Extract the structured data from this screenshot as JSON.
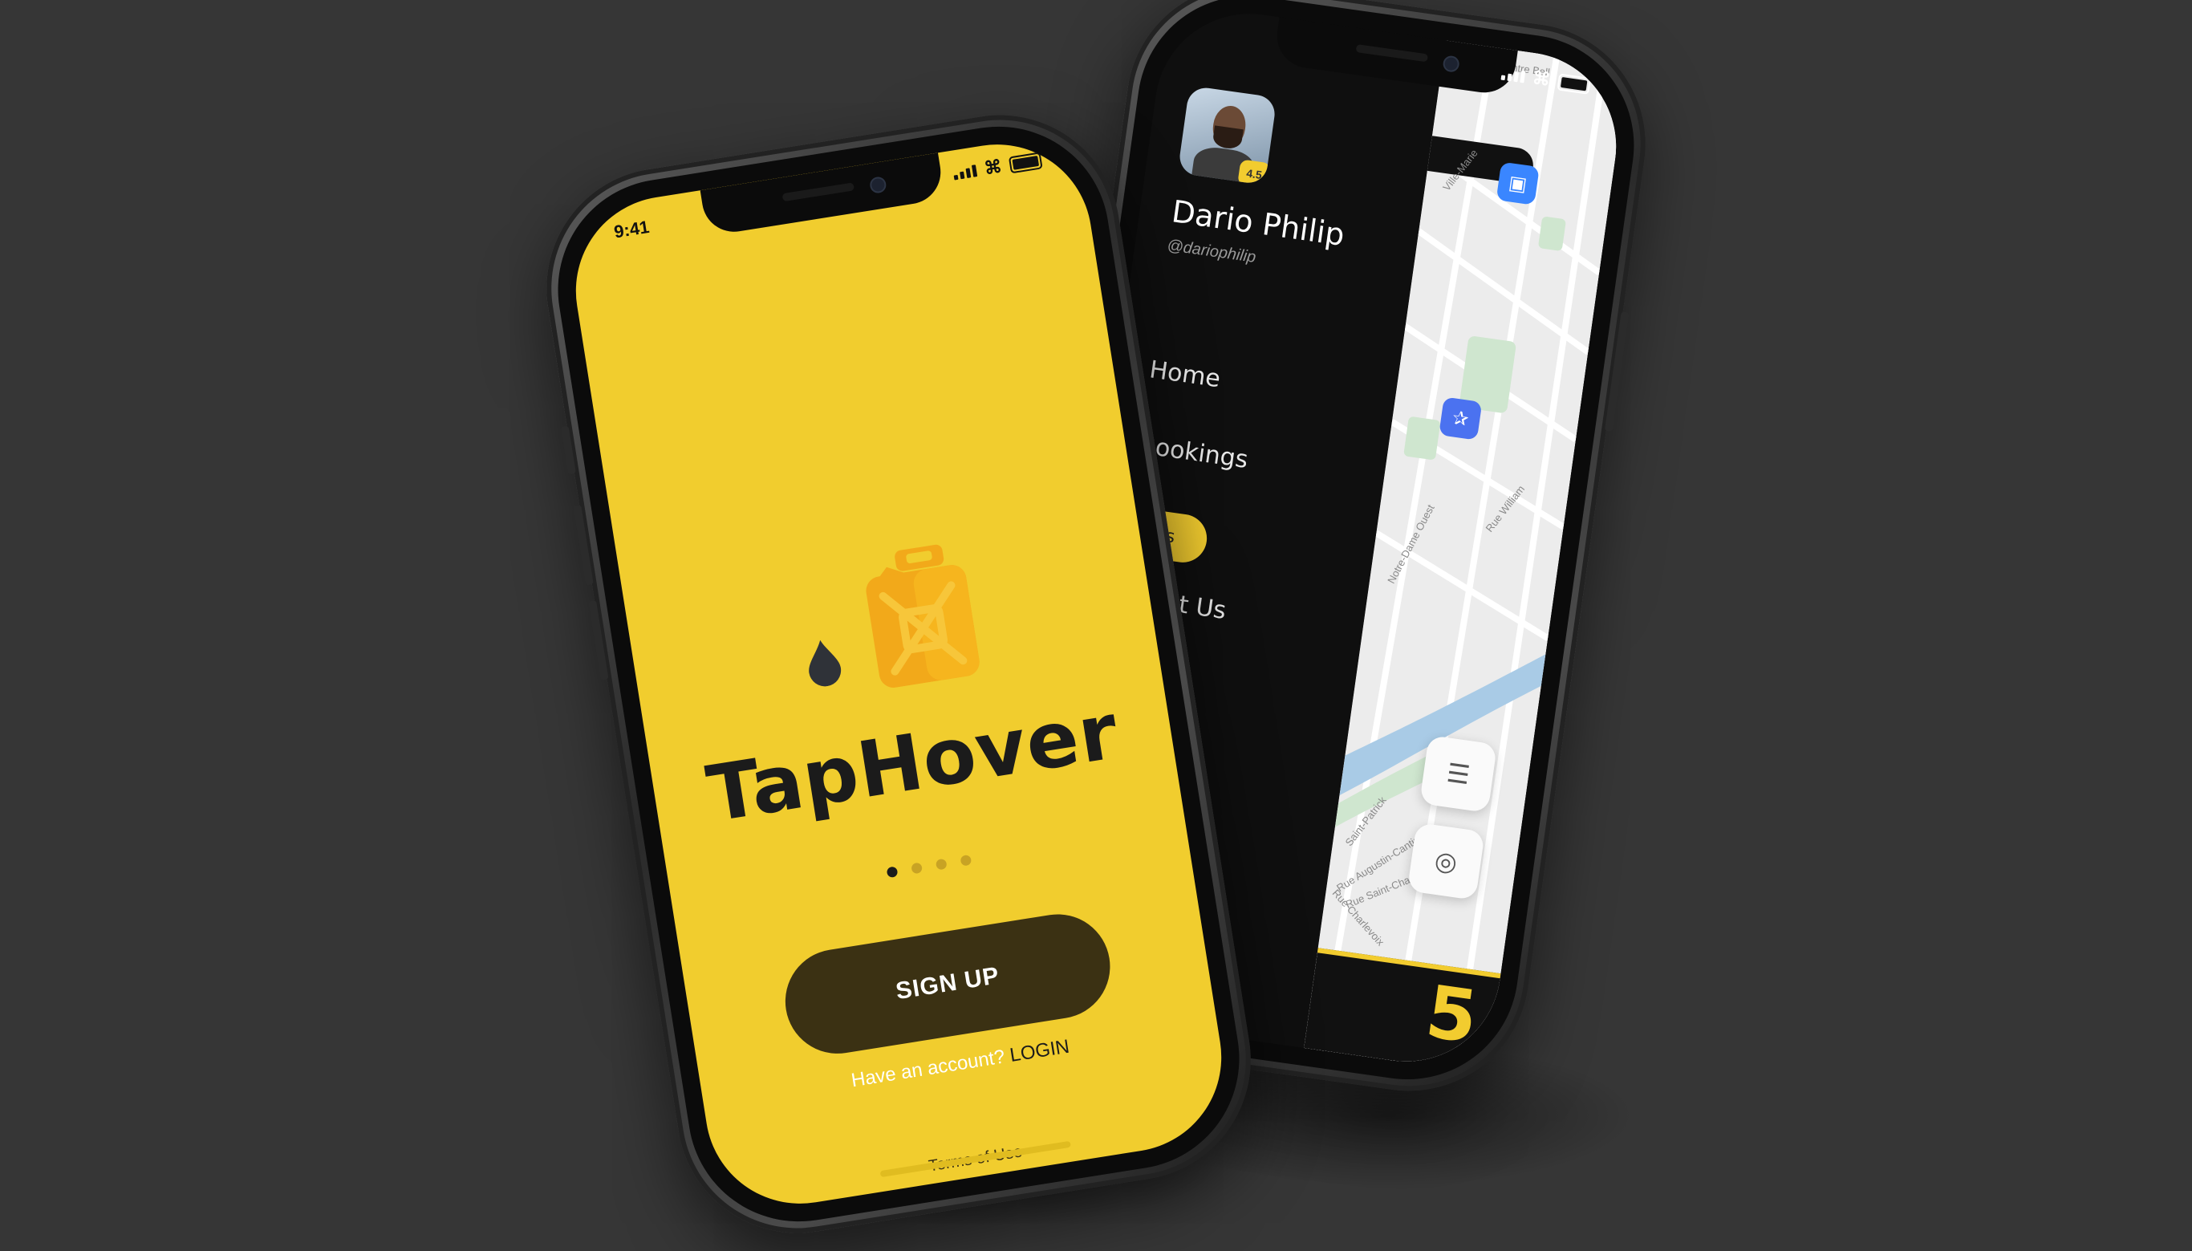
{
  "back_phone": {
    "profile": {
      "name": "Dario Philip",
      "handle": "@dariophilip",
      "badge": "4.5"
    },
    "menu": [
      {
        "label": "Home"
      },
      {
        "label": "Bookings"
      },
      {
        "label": "Tips"
      },
      {
        "label": "About Us"
      }
    ],
    "map": {
      "street_labels": [
        "Centre Bell",
        "Ville-Marie",
        "Rue William",
        "Notre-Dame Ouest",
        "Saint-Patrick",
        "Rue Augustin-Cantin",
        "Rue Saint-Charles",
        "Rue Charlevoix"
      ],
      "pins": [
        {
          "icon": "store-icon"
        },
        {
          "icon": "restaurant-icon"
        }
      ],
      "controls": [
        {
          "icon": "filter-sliders-icon"
        },
        {
          "icon": "locate-target-icon"
        }
      ]
    },
    "footer_number": "5",
    "colors": {
      "accent": "#f2cc2f",
      "background": "#0f0f0f",
      "pin": "#3a86ff"
    }
  },
  "front_phone": {
    "status": {
      "time": "9:41"
    },
    "brand": "TapHover",
    "pager": {
      "total": 4,
      "active_index": 0
    },
    "signup_label": "SIGN UP",
    "have_account": "Have an account?",
    "login_label": "LOGIN",
    "terms": "Terms of Use",
    "colors": {
      "screen": "#f1cd2e",
      "button": "#3b3113",
      "text": "#1b1b1b"
    }
  }
}
